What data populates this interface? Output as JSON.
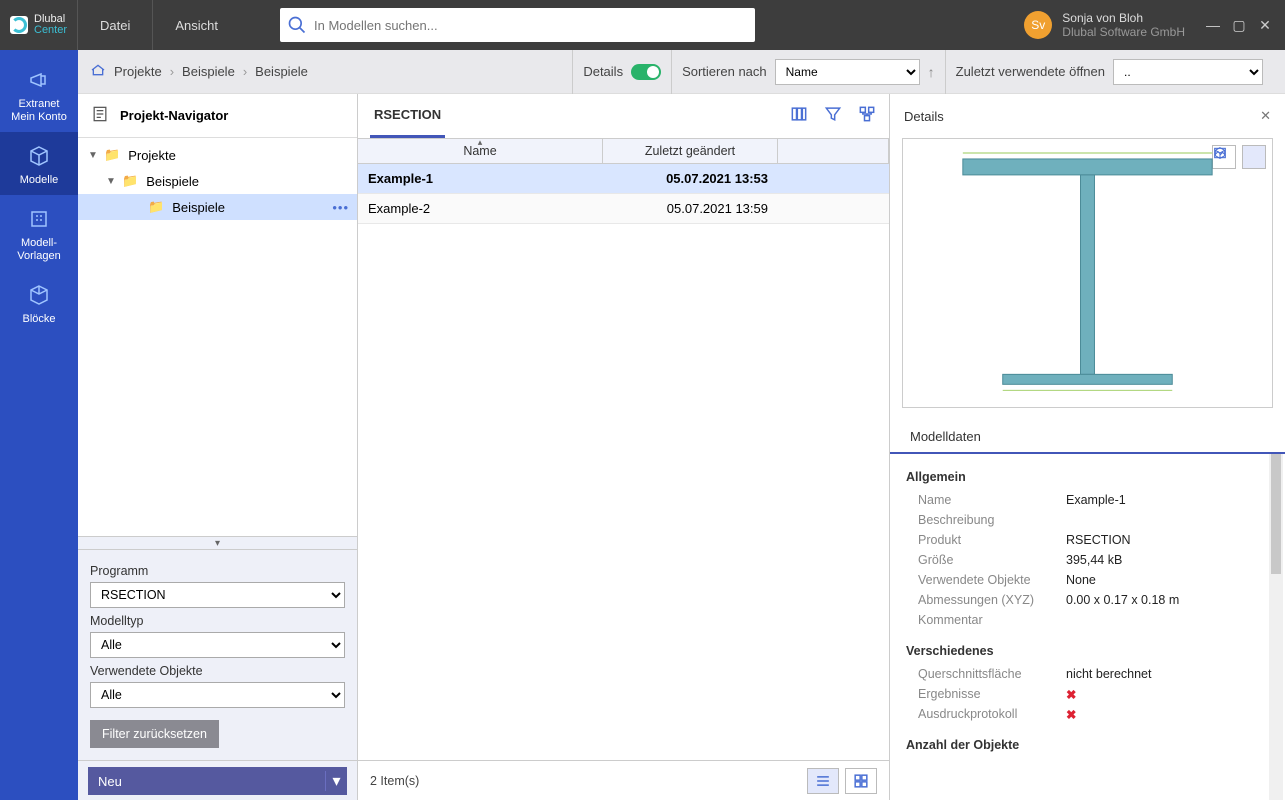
{
  "app": {
    "brand1": "Dlubal",
    "brand2": "Center"
  },
  "menu": {
    "file": "Datei",
    "view": "Ansicht"
  },
  "search": {
    "placeholder": "In Modellen suchen..."
  },
  "user": {
    "initials": "Sv",
    "name": "Sonja von Bloh",
    "company": "Dlubal Software GmbH"
  },
  "rail": {
    "items": [
      {
        "label": "Extranet\nMein Konto"
      },
      {
        "label": "Modelle"
      },
      {
        "label": "Modell-\nVorlagen"
      },
      {
        "label": "Blöcke"
      }
    ]
  },
  "toolbar": {
    "crumbs": [
      "Projekte",
      "Beispiele",
      "Beispiele"
    ],
    "details": "Details",
    "sort_label": "Sortieren nach",
    "sort_value": "Name",
    "recent_label": "Zuletzt verwendete öffnen",
    "recent_value": ".."
  },
  "navigator": {
    "title": "Projekt-Navigator",
    "tree": {
      "root": "Projekte",
      "l1": "Beispiele",
      "l2": "Beispiele"
    },
    "filters": {
      "program_label": "Programm",
      "program_value": "RSECTION",
      "modeltype_label": "Modelltyp",
      "modeltype_value": "Alle",
      "objects_label": "Verwendete Objekte",
      "objects_value": "Alle",
      "reset": "Filter zurücksetzen"
    },
    "new_button": "Neu"
  },
  "list": {
    "tab": "RSECTION",
    "columns": {
      "name": "Name",
      "modified": "Zuletzt geändert"
    },
    "rows": [
      {
        "name": "Example-1",
        "modified": "05.07.2021 13:53",
        "selected": true
      },
      {
        "name": "Example-2",
        "modified": "05.07.2021 13:59",
        "selected": false
      }
    ],
    "footer": "2 Item(s)"
  },
  "details": {
    "title": "Details",
    "tab": "Modelldaten",
    "sections": {
      "general": {
        "heading": "Allgemein",
        "rows": {
          "name_k": "Name",
          "name_v": "Example-1",
          "desc_k": "Beschreibung",
          "desc_v": "",
          "product_k": "Produkt",
          "product_v": "RSECTION",
          "size_k": "Größe",
          "size_v": "395,44 kB",
          "objects_k": "Verwendete Objekte",
          "objects_v": "None",
          "dim_k": "Abmessungen (XYZ)",
          "dim_v": "0.00 x 0.17 x 0.18 m",
          "comment_k": "Kommentar",
          "comment_v": ""
        }
      },
      "misc": {
        "heading": "Verschiedenes",
        "rows": {
          "area_k": "Querschnittsfläche",
          "area_v": "nicht berechnet",
          "results_k": "Ergebnisse",
          "printout_k": "Ausdruckprotokoll"
        }
      },
      "objects": {
        "heading": "Anzahl der Objekte"
      }
    }
  }
}
